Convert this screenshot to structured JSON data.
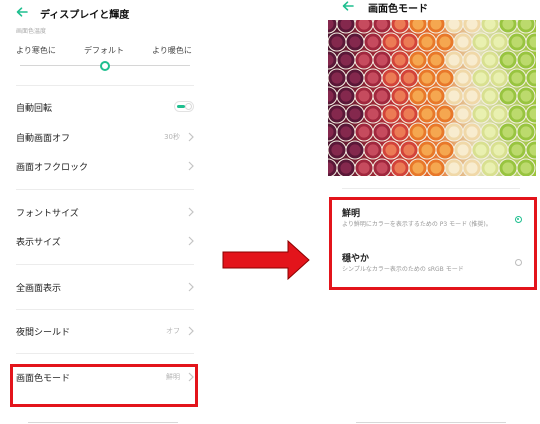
{
  "left": {
    "title": "ディスプレイと輝度",
    "temp_section_caption": "画面色温度",
    "temp_slider": {
      "cooler_label": "より寒色に",
      "default_label": "デフォルト",
      "warmer_label": "より暖色に",
      "level_fraction": 0.5
    },
    "settings": [
      {
        "label": "自動回転",
        "value": "",
        "toggle_on": true
      },
      {
        "label": "自動画面オフ",
        "value": "30秒"
      },
      {
        "label": "画面オフクロック",
        "value": ""
      },
      {
        "label": "フォントサイズ",
        "value": ""
      },
      {
        "label": "表示サイズ",
        "value": ""
      },
      {
        "label": "全画面表示",
        "value": ""
      },
      {
        "label": "夜間シールド",
        "value": "オフ"
      },
      {
        "label": "画面色モード",
        "value": "鮮明"
      }
    ]
  },
  "right": {
    "title": "画面色モード",
    "options": [
      {
        "title": "鮮明",
        "desc": "より鮮明にカラーを表示するための P3 モード (推奨)。",
        "selected": true
      },
      {
        "title": "穏やか",
        "desc": "シンプルなカラー表示のための sRGB モード",
        "selected": false
      }
    ]
  },
  "colors": {
    "accent": "#1fbf8f",
    "highlight": "#e3141b"
  }
}
